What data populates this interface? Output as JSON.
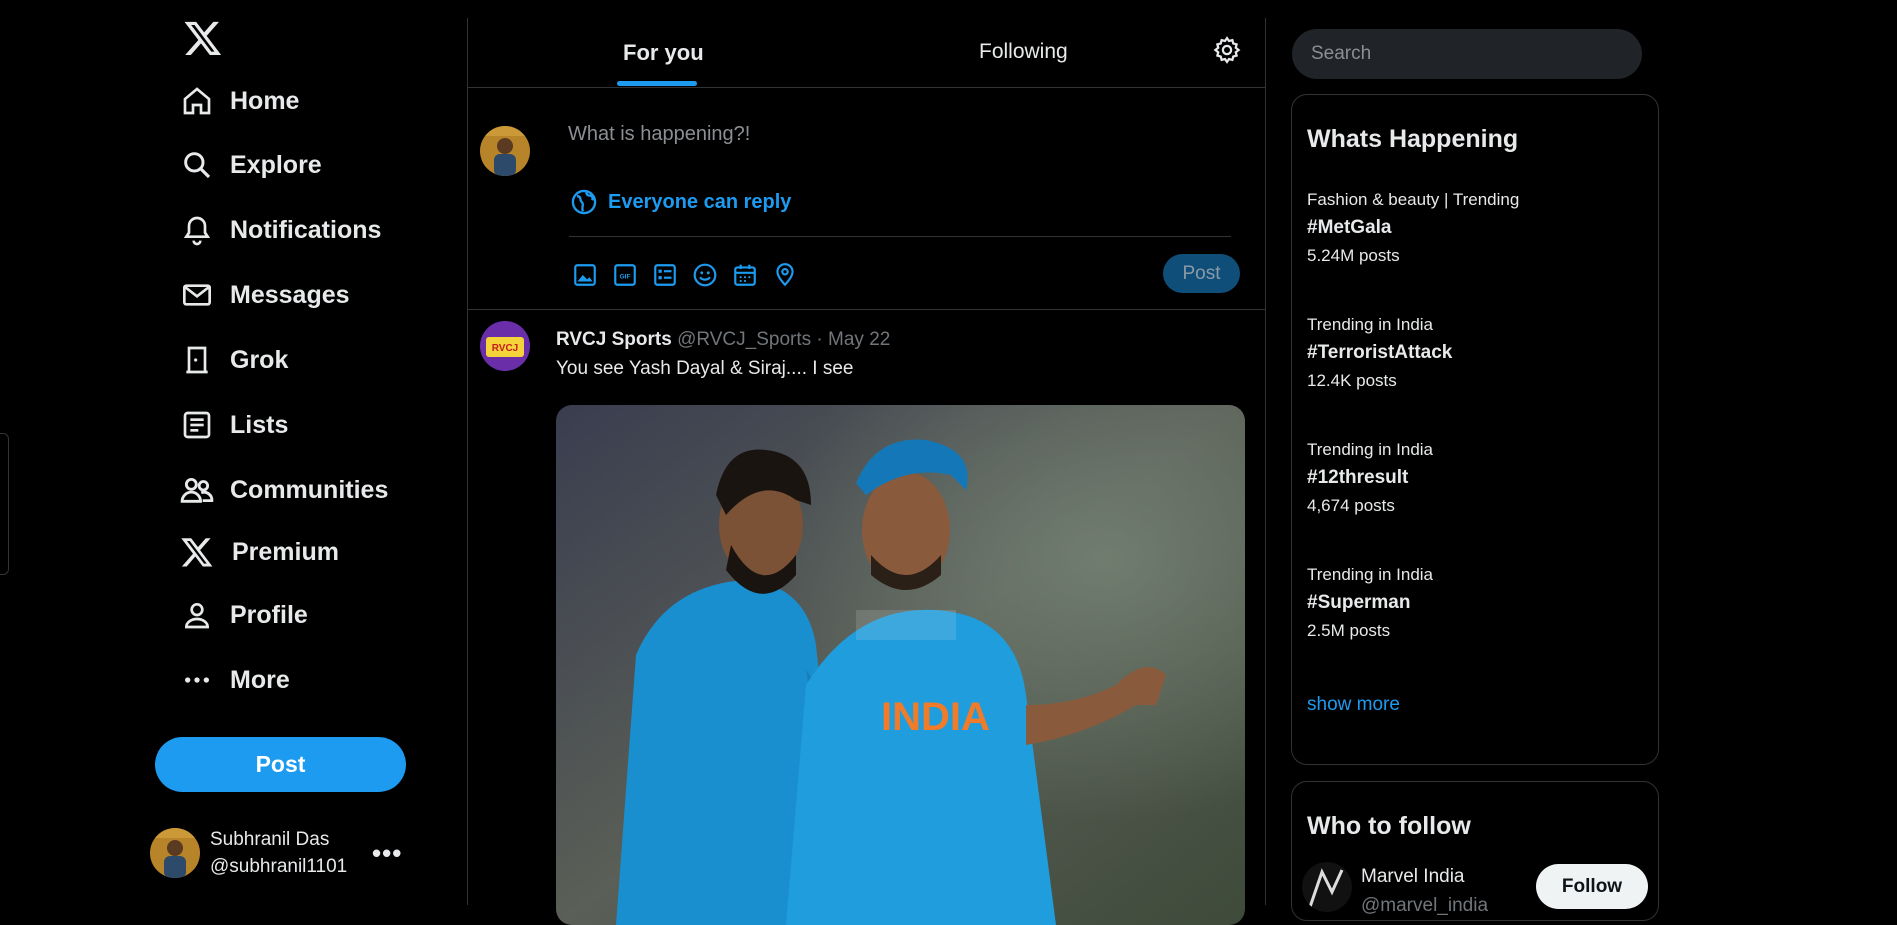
{
  "sidebar": {
    "logo_icon": "x-logo-icon",
    "items": [
      {
        "label": "Home",
        "icon": "home-icon"
      },
      {
        "label": "Explore",
        "icon": "search-icon"
      },
      {
        "label": "Notifications",
        "icon": "bell-icon"
      },
      {
        "label": "Messages",
        "icon": "mail-icon"
      },
      {
        "label": "Grok",
        "icon": "grok-icon"
      },
      {
        "label": "Lists",
        "icon": "list-icon"
      },
      {
        "label": "Communities",
        "icon": "communities-icon"
      },
      {
        "label": "Premium",
        "icon": "x-logo-icon"
      },
      {
        "label": "Profile",
        "icon": "person-icon"
      },
      {
        "label": "More",
        "icon": "more-dots-icon"
      }
    ],
    "post_label": "Post",
    "account": {
      "name": "Subhranil Das",
      "handle": "@subhranil1101",
      "more": "•••"
    }
  },
  "timeline": {
    "tabs": [
      {
        "label": "For you",
        "active": true
      },
      {
        "label": "Following",
        "active": false
      }
    ],
    "composer": {
      "placeholder": "What is happening?!",
      "reply_setting": "Everyone can reply",
      "post_label": "Post",
      "tools": [
        "image-icon",
        "gif-icon",
        "poll-icon",
        "emoji-icon",
        "schedule-icon",
        "location-icon"
      ]
    },
    "tweet": {
      "author": "RVCJ Sports",
      "handle": "@RVCJ_Sports",
      "separator": "·",
      "date": "May 22",
      "text": "You see Yash Dayal & Siraj.... I see",
      "jersey_text": "INDIA"
    }
  },
  "right": {
    "search_placeholder": "Search",
    "trends_title": "Whats Happening",
    "trends": [
      {
        "category": "Fashion & beauty | Trending",
        "tag": "#MetGala",
        "count": "5.24M posts"
      },
      {
        "category": "Trending in India",
        "tag": "#TerroristAttack",
        "count": "12.4K posts"
      },
      {
        "category": "Trending in India",
        "tag": "#12thresult",
        "count": "4,674 posts"
      },
      {
        "category": "Trending in India",
        "tag": "#Superman",
        "count": "2.5M posts"
      }
    ],
    "show_more": "show more",
    "who_title": "Who to follow",
    "follow": {
      "name": "Marvel India",
      "handle": "@marvel_india",
      "button": "Follow"
    }
  },
  "colors": {
    "accent": "#1d9bf0",
    "background": "#000000",
    "border": "#2f3336"
  }
}
